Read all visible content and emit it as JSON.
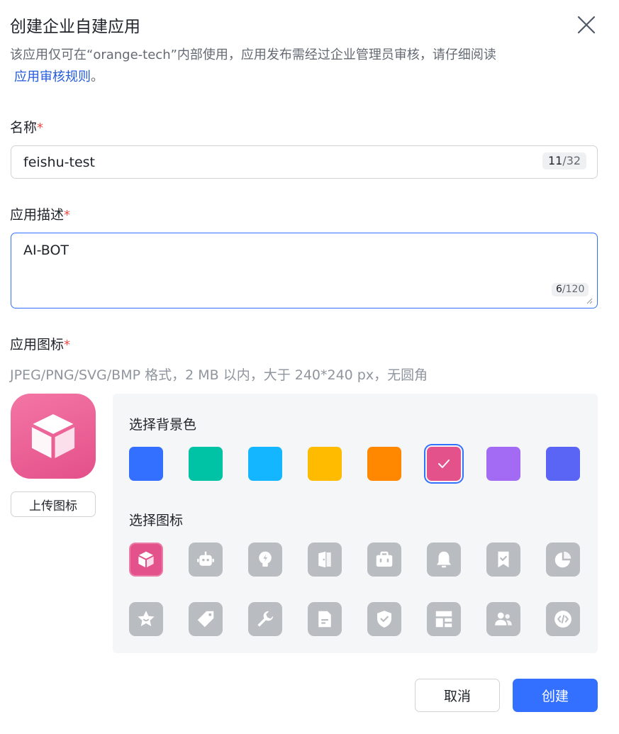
{
  "dialog": {
    "title": "创建企业自建应用",
    "intro_text": "该应用仅可在“orange-tech”内部使用，应用发布需经过企业管理员审核，请仔细阅读",
    "intro_link": "应用审核规则",
    "intro_end": "。"
  },
  "name_field": {
    "label": "名称",
    "required_mark": "*",
    "value": "feishu-test",
    "count": "11",
    "max": "/32"
  },
  "desc_field": {
    "label": "应用描述",
    "required_mark": "*",
    "value": "AI-BOT",
    "count": "6",
    "max": "/120"
  },
  "icon_field": {
    "label": "应用图标",
    "required_mark": "*",
    "hint": "JPEG/PNG/SVG/BMP 格式，2 MB 以内，大于 240*240 px，无圆角",
    "upload_label": "上传图标",
    "bg_title": "选择背景色",
    "icon_title": "选择图标",
    "colors": [
      "#3370ff",
      "#00c3a5",
      "#14b7ff",
      "#ffbb00",
      "#ff8800",
      "#e4528b",
      "#a36bf4",
      "#5b65f5"
    ],
    "selected_color_index": 5,
    "icons": [
      "cube-icon",
      "robot-icon",
      "lightbulb-icon",
      "door-icon",
      "briefcase-icon",
      "bell-icon",
      "bookmark-check-icon",
      "pie-chart-icon",
      "star-face-icon",
      "tag-icon",
      "wrench-icon",
      "document-icon",
      "shield-check-icon",
      "layout-icon",
      "people-icon",
      "code-icon"
    ],
    "selected_icon_index": 0
  },
  "footer": {
    "cancel_label": "取消",
    "create_label": "创建"
  }
}
